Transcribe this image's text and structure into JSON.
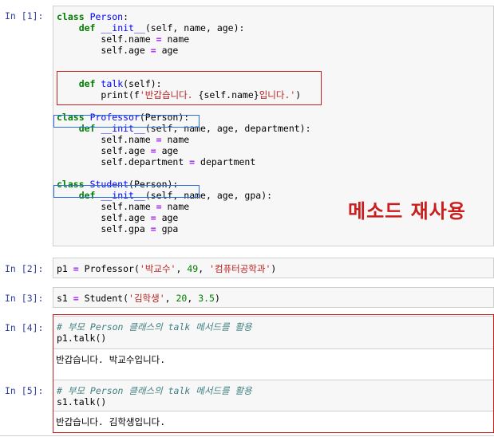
{
  "cells": [
    {
      "prompt": "In [1]:"
    },
    {
      "prompt": "In [2]:"
    },
    {
      "prompt": "In [3]:"
    },
    {
      "prompt": "In [4]:",
      "output": "반갑습니다. 박교수입니다."
    },
    {
      "prompt": "In [5]:",
      "output": "반갑습니다. 김학생입니다."
    }
  ],
  "annotation": "메소드  재사용",
  "colors": {
    "highlight_red": "#c81e1e",
    "highlight_blue": "#2a6fdb",
    "prompt": "#303f9f"
  }
}
